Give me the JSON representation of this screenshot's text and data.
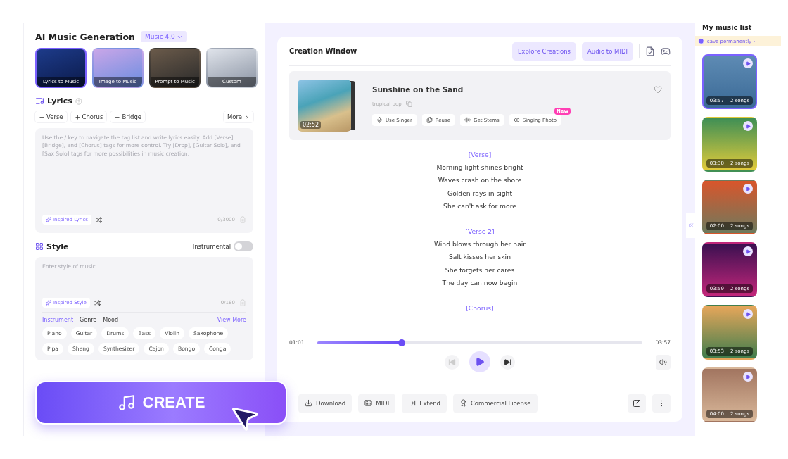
{
  "generator": {
    "title": "AI Music Generation",
    "model": "Music 4.0"
  },
  "modes": [
    {
      "label": "Lyrics to Music",
      "selected": true
    },
    {
      "label": "Image to Music",
      "selected": false
    },
    {
      "label": "Prompt to Music",
      "selected": false
    },
    {
      "label": "Custom",
      "selected": false
    }
  ],
  "lyrics": {
    "title": "Lyrics",
    "tags": [
      "Verse",
      "Chorus",
      "Bridge"
    ],
    "more": "More",
    "placeholder": "Use the / key to navigate the tag list and write lyrics easily. Add [Verse], [Bridge], and [Chorus] tags for more control. Try [Drop], [Guitar Solo], and [Sax Solo] tags for more possibilities in music creation.",
    "inspire": "Inspired Lyrics",
    "count": "0/3000"
  },
  "style": {
    "title": "Style",
    "instrumental": {
      "label": "Instrumental",
      "on": false
    },
    "placeholder": "Enter style of music",
    "inspire": "Inspired Style",
    "count": "0/180",
    "categories": [
      {
        "label": "Instrument",
        "selected": true
      },
      {
        "label": "Genre",
        "selected": false
      },
      {
        "label": "Mood",
        "selected": false
      }
    ],
    "view_more": "View More",
    "chips": [
      "Piano",
      "Guitar",
      "Drums",
      "Bass",
      "Violin",
      "Saxophone",
      "Pipa",
      "Sheng",
      "Synthesizer",
      "Cajon",
      "Bongo",
      "Conga"
    ]
  },
  "create": {
    "label": "CREATE"
  },
  "creation": {
    "title": "Creation Window",
    "buttons": [
      "Explore Creations",
      "Audio to MIDI"
    ],
    "song": {
      "title": "Sunshine on the Sand",
      "genre": "tropical pop",
      "duration": "02:52",
      "liked": false,
      "actions": [
        {
          "label": "Use Singer",
          "kind": "singer"
        },
        {
          "label": "Reuse",
          "kind": "reuse"
        },
        {
          "label": "Get Stems",
          "kind": "stems"
        },
        {
          "label": "Singing Photo",
          "kind": "photo",
          "badge": "New"
        }
      ]
    },
    "lyrics": [
      {
        "kind": "tag",
        "text": "[Verse]"
      },
      {
        "kind": "line",
        "text": "Morning light shines bright"
      },
      {
        "kind": "line",
        "text": "Waves crash on the shore"
      },
      {
        "kind": "line",
        "text": "Golden rays in sight"
      },
      {
        "kind": "line",
        "text": "She can't ask for more"
      },
      {
        "kind": "tag",
        "text": "[Verse 2]"
      },
      {
        "kind": "line",
        "text": "Wind blows through her hair"
      },
      {
        "kind": "line",
        "text": "Salt kisses her skin"
      },
      {
        "kind": "line",
        "text": "She forgets her cares"
      },
      {
        "kind": "line",
        "text": "The day can now begin"
      },
      {
        "kind": "tag",
        "text": "[Chorus]"
      }
    ],
    "player": {
      "elapsed": "01:01",
      "total": "03:57",
      "level": 0.26
    },
    "footer": [
      {
        "label": "Download",
        "kind": "download"
      },
      {
        "label": "MIDI",
        "kind": "midi"
      },
      {
        "label": "Extend",
        "kind": "extend"
      },
      {
        "label": "Commercial License",
        "kind": "license"
      }
    ]
  },
  "music_list": {
    "title": "My music list",
    "notice": "save permanently ›",
    "items": [
      {
        "duration": "03:57",
        "count": "2 songs",
        "selected": true
      },
      {
        "duration": "03:30",
        "count": "2 songs",
        "selected": false
      },
      {
        "duration": "02:00",
        "count": "2 songs",
        "selected": false
      },
      {
        "duration": "03:59",
        "count": "2 songs",
        "selected": false
      },
      {
        "duration": "03:53",
        "count": "2 songs",
        "selected": false
      },
      {
        "duration": "04:00",
        "count": "2 songs",
        "selected": false
      }
    ]
  }
}
